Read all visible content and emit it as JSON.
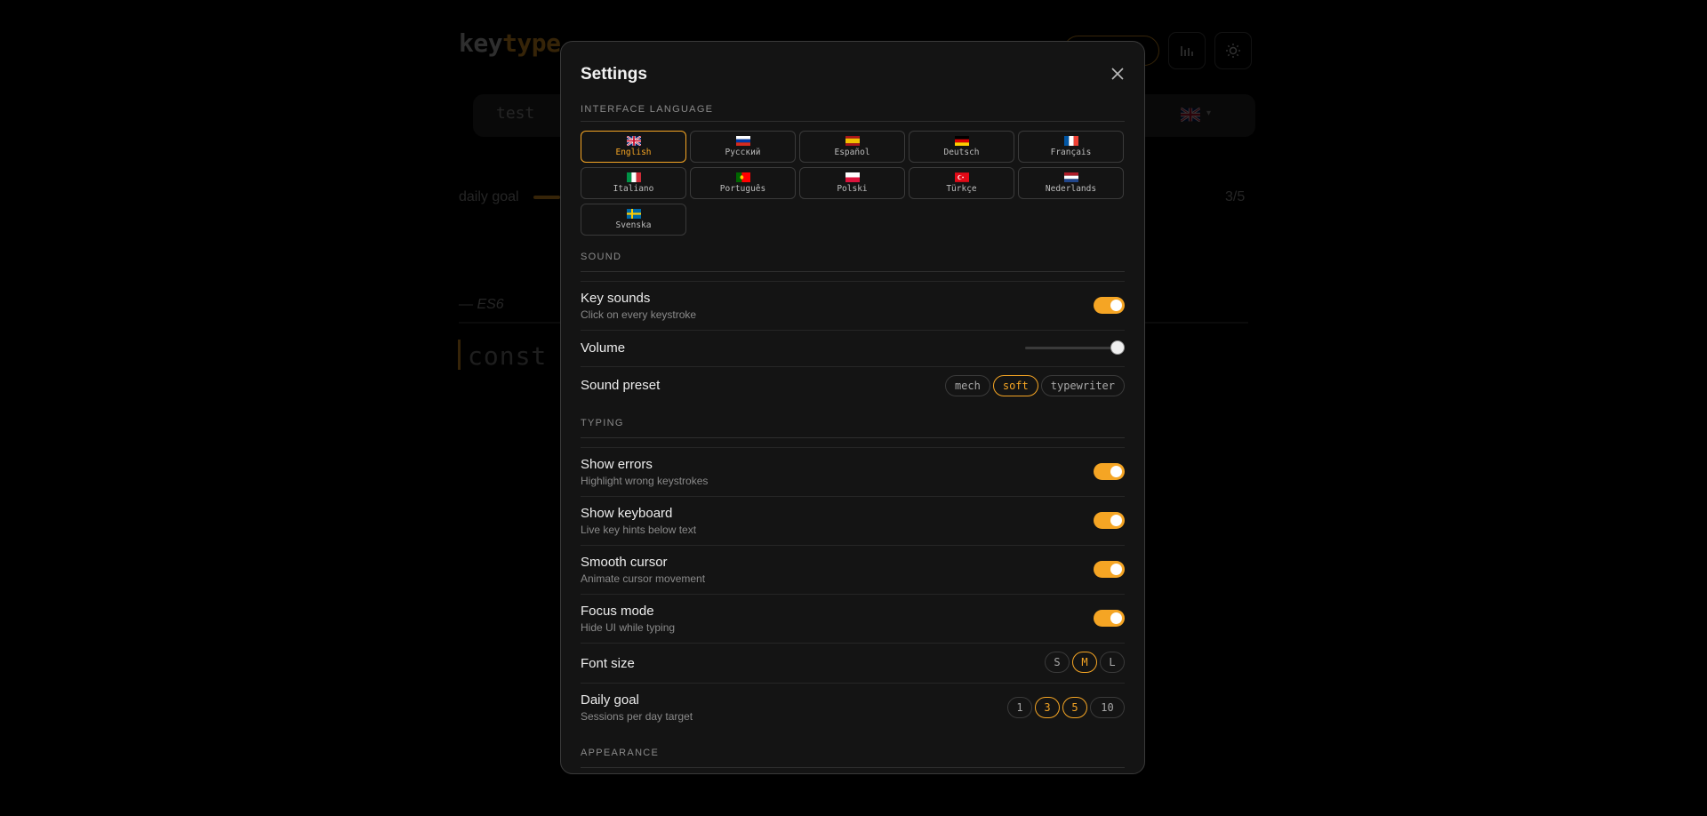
{
  "background": {
    "logo_part1": "key",
    "logo_part2": "type",
    "input_text": "test",
    "goal_label": "daily goal",
    "goal_count": "3/5",
    "source_label": "— ES6",
    "code_text": "const a"
  },
  "modal": {
    "title": "Settings",
    "sections": {
      "language": "Interface language",
      "sound": "Sound",
      "typing": "Typing",
      "appearance": "Appearance"
    },
    "languages": [
      {
        "label": "English",
        "flag": "gb",
        "active": true
      },
      {
        "label": "Русский",
        "flag": "ru",
        "active": false
      },
      {
        "label": "Español",
        "flag": "es",
        "active": false
      },
      {
        "label": "Deutsch",
        "flag": "de",
        "active": false
      },
      {
        "label": "Français",
        "flag": "fr",
        "active": false
      },
      {
        "label": "Italiano",
        "flag": "it",
        "active": false
      },
      {
        "label": "Português",
        "flag": "pt",
        "active": false
      },
      {
        "label": "Polski",
        "flag": "pl",
        "active": false
      },
      {
        "label": "Türkçe",
        "flag": "tr",
        "active": false
      },
      {
        "label": "Nederlands",
        "flag": "nl",
        "active": false
      },
      {
        "label": "Svenska",
        "flag": "se",
        "active": false
      }
    ],
    "sound": {
      "key_sounds": {
        "title": "Key sounds",
        "subtitle": "Click on every keystroke",
        "on": true
      },
      "volume": {
        "title": "Volume",
        "level": 1.0
      },
      "preset": {
        "title": "Sound preset",
        "options": [
          "mech",
          "soft",
          "typewriter"
        ],
        "selected": "soft"
      }
    },
    "typing": {
      "show_errors": {
        "title": "Show errors",
        "subtitle": "Highlight wrong keystrokes",
        "on": true
      },
      "show_keyboard": {
        "title": "Show keyboard",
        "subtitle": "Live key hints below text",
        "on": true
      },
      "smooth_cursor": {
        "title": "Smooth cursor",
        "subtitle": "Animate cursor movement",
        "on": true
      },
      "focus_mode": {
        "title": "Focus mode",
        "subtitle": "Hide UI while typing",
        "on": true
      },
      "font_size": {
        "title": "Font size",
        "options": [
          "S",
          "M",
          "L"
        ],
        "selected": "M"
      },
      "daily_goal": {
        "title": "Daily goal",
        "subtitle": "Sessions per day target",
        "options": [
          "1",
          "3",
          "5",
          "10"
        ],
        "selected": [
          "3",
          "5"
        ]
      }
    }
  },
  "colors": {
    "accent": "#f5a524",
    "modal_bg": "#141414",
    "page_bg": "#000000"
  }
}
